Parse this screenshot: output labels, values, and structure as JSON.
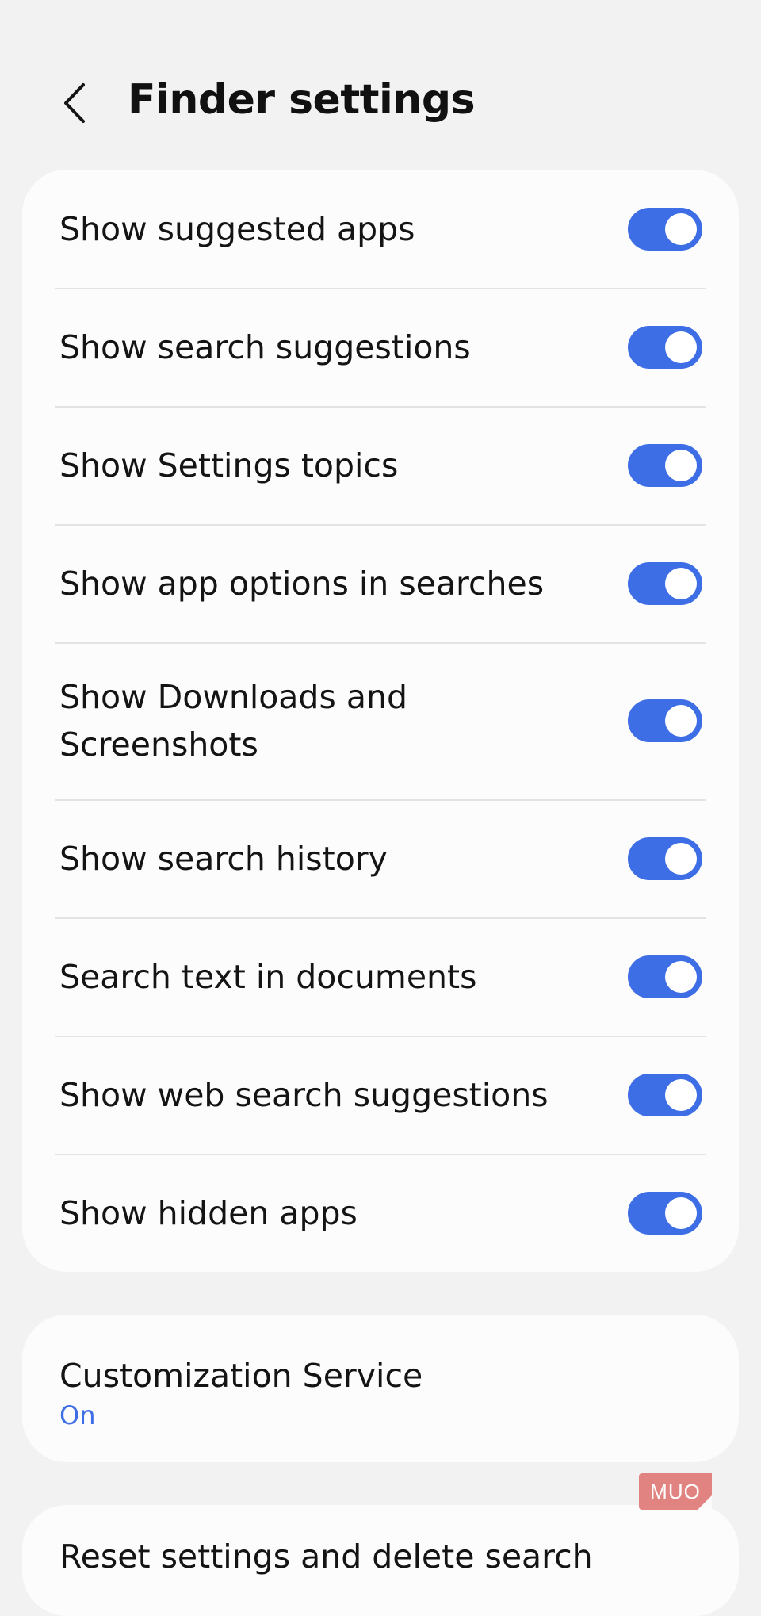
{
  "header": {
    "back_icon": "chevron-left-icon",
    "title": "Finder settings"
  },
  "toggles": [
    {
      "label": "Show suggested apps",
      "on": true
    },
    {
      "label": "Show search suggestions",
      "on": true
    },
    {
      "label": "Show Settings topics",
      "on": true
    },
    {
      "label": "Show app options in searches",
      "on": true
    },
    {
      "label": "Show Downloads and Screenshots",
      "on": true
    },
    {
      "label": "Show search history",
      "on": true
    },
    {
      "label": "Search text in documents",
      "on": true
    },
    {
      "label": "Show web search suggestions",
      "on": true
    },
    {
      "label": "Show hidden apps",
      "on": true
    }
  ],
  "customization": {
    "title": "Customization Service",
    "status": "On"
  },
  "reset": {
    "label": "Reset settings and delete search"
  },
  "watermark": {
    "text": "MUO"
  },
  "colors": {
    "accent": "#3e6ee6",
    "background": "#f2f2f2",
    "card": "#fcfcfc",
    "watermark": "#e07a78"
  }
}
